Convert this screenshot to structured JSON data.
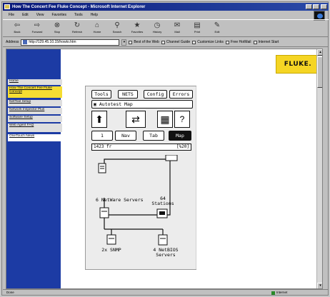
{
  "window": {
    "title": "How The Concert Fee Fluke Concept - Microsoft Internet Explorer"
  },
  "menu": [
    "File",
    "Edit",
    "View",
    "Favorites",
    "Tools",
    "Help"
  ],
  "toolbar": [
    {
      "label": "Back",
      "icon": "back-arrow-icon"
    },
    {
      "label": "Forward",
      "icon": "forward-arrow-icon"
    },
    {
      "label": "Stop",
      "icon": "stop-icon"
    },
    {
      "label": "Refresh",
      "icon": "refresh-icon"
    },
    {
      "label": "Home",
      "icon": "home-icon"
    },
    {
      "label": "Search",
      "icon": "search-icon"
    },
    {
      "label": "Favorites",
      "icon": "favorites-icon"
    },
    {
      "label": "History",
      "icon": "history-icon"
    },
    {
      "label": "Mail",
      "icon": "mail-icon"
    },
    {
      "label": "Print",
      "icon": "print-icon"
    },
    {
      "label": "Edit",
      "icon": "edit-icon"
    }
  ],
  "address": {
    "label": "Address",
    "value": "http://129.45.10.15/howto.htm",
    "links": [
      "Best of the Web",
      "Channel Guide",
      "Customize Links",
      "Free HotMail",
      "Internet Start"
    ]
  },
  "sidebar": {
    "items": [
      {
        "label": "Home",
        "state": "normal"
      },
      {
        "label": "How The Concert Fee Fluke Concept",
        "state": "active"
      },
      {
        "label": "NetTool Setup",
        "state": "normal"
      },
      {
        "label": "Network Inspector Plus",
        "state": "normal"
      },
      {
        "label": "Software Setup",
        "state": "normal"
      },
      {
        "label": "Web Agent FAQ",
        "state": "normal"
      },
      {
        "label": "OneTouch News",
        "state": "plain"
      }
    ]
  },
  "brand": {
    "logo_text": "FLUKE."
  },
  "device": {
    "tabs": [
      "Tools",
      "NETS",
      "Config",
      "Errors"
    ],
    "screen_title": "Autotest Map",
    "mode_tabs": [
      "1",
      "Nav",
      "Tab",
      "Map"
    ],
    "active_mode": "Map",
    "status_left": "1423 fr",
    "status_right": "[%20]",
    "map": {
      "nodes": [
        {
          "label": "6 NetWare Servers",
          "icon": "server-icon"
        },
        {
          "label": "64 Stations",
          "icon": "workstation-icon"
        },
        {
          "label": "2x SNMP",
          "icon": "snmp-device-icon"
        },
        {
          "label": "4 NetBIOS Servers",
          "icon": "server-icon"
        }
      ]
    }
  },
  "statusbar": {
    "left": "Done",
    "zone": "Internet"
  }
}
